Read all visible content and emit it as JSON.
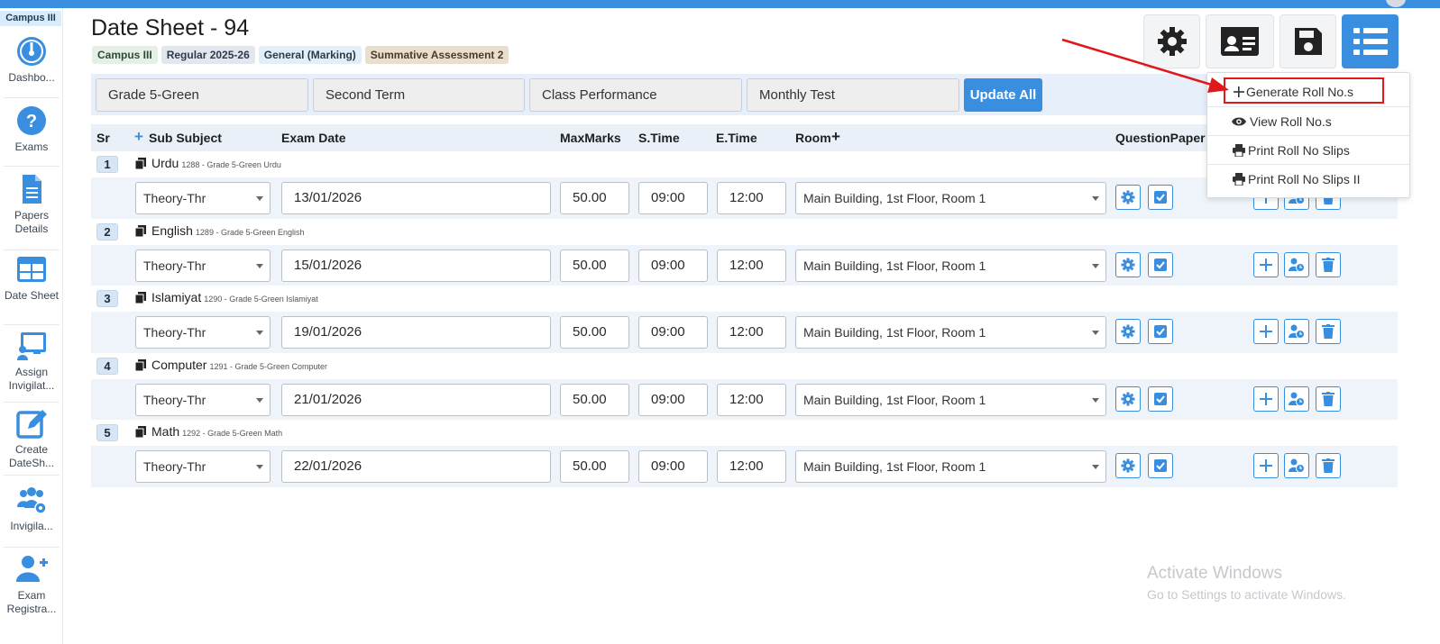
{
  "sidebar": {
    "campus": "Campus III",
    "items": [
      {
        "label": "Dashbo...",
        "icon": "dashboard-icon"
      },
      {
        "label": "Exams",
        "icon": "question-icon"
      },
      {
        "label": "Papers Details",
        "icon": "document-icon"
      },
      {
        "label": "Date Sheet",
        "icon": "table-icon"
      },
      {
        "label": "Assign Invigilat...",
        "icon": "presentation-icon"
      },
      {
        "label": "Create DateSh...",
        "icon": "edit-icon"
      },
      {
        "label": "Invigila...",
        "icon": "users-gear-icon"
      },
      {
        "label": "Exam Registra...",
        "icon": "user-add-icon"
      }
    ]
  },
  "header": {
    "title": "Date Sheet - 94",
    "badges": [
      "Campus III",
      "Regular 2025-26",
      "General (Marking)",
      "Summative Assessment 2"
    ]
  },
  "toolbar": {
    "buttons": [
      "settings-icon",
      "id-card-icon",
      "save-icon",
      "list-icon"
    ]
  },
  "filters": {
    "grade": "Grade 5-Green",
    "term": "Second Term",
    "category": "Class Performance",
    "test": "Monthly Test",
    "update_all": "Update All"
  },
  "table": {
    "headers": {
      "sr": "Sr",
      "subject": "Sub Subject",
      "date": "Exam Date",
      "max": "MaxMarks",
      "stime": "S.Time",
      "etime": "E.Time",
      "room": "Room",
      "qp": "QuestionPaper"
    },
    "rows": [
      {
        "sr": "1",
        "subject": "Urdu",
        "meta": "1288 - Grade 5-Green Urdu",
        "type": "Theory-Thr",
        "date": "13/01/2026",
        "max": "50.00",
        "stime": "09:00",
        "etime": "12:00",
        "room": "Main Building, 1st Floor, Room 1"
      },
      {
        "sr": "2",
        "subject": "English",
        "meta": "1289 - Grade 5-Green English",
        "type": "Theory-Thr",
        "date": "15/01/2026",
        "max": "50.00",
        "stime": "09:00",
        "etime": "12:00",
        "room": "Main Building, 1st Floor, Room 1"
      },
      {
        "sr": "3",
        "subject": "Islamiyat",
        "meta": "1290 - Grade 5-Green Islamiyat",
        "type": "Theory-Thr",
        "date": "19/01/2026",
        "max": "50.00",
        "stime": "09:00",
        "etime": "12:00",
        "room": "Main Building, 1st Floor, Room 1"
      },
      {
        "sr": "4",
        "subject": "Computer",
        "meta": "1291 - Grade 5-Green Computer",
        "type": "Theory-Thr",
        "date": "21/01/2026",
        "max": "50.00",
        "stime": "09:00",
        "etime": "12:00",
        "room": "Main Building, 1st Floor, Room 1"
      },
      {
        "sr": "5",
        "subject": "Math",
        "meta": "1292 - Grade 5-Green Math",
        "type": "Theory-Thr",
        "date": "22/01/2026",
        "max": "50.00",
        "stime": "09:00",
        "etime": "12:00",
        "room": "Main Building, 1st Floor, Room 1"
      }
    ]
  },
  "dropdown": {
    "items": [
      {
        "label": "Generate Roll No.s",
        "icon": "plus-icon"
      },
      {
        "label": "View Roll No.s",
        "icon": "eye-icon"
      },
      {
        "label": "Print Roll No Slips",
        "icon": "printer-icon"
      },
      {
        "label": "Print Roll No Slips II",
        "icon": "printer-icon"
      }
    ]
  },
  "watermark": {
    "line1": "Activate Windows",
    "line2": "Go to Settings to activate Windows."
  },
  "colors": {
    "primary": "#3a8ee0",
    "highlight": "#e0171b"
  }
}
